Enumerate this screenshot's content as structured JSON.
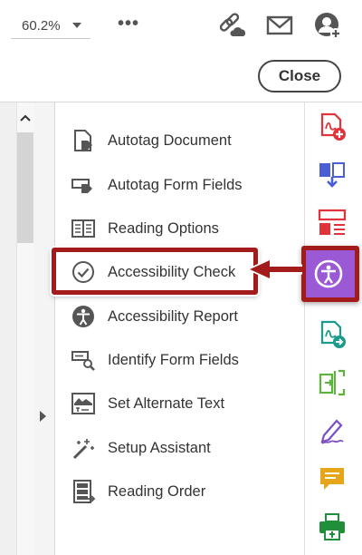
{
  "toolbar": {
    "zoom_value": "60.2%",
    "more_label": "•••",
    "icons": [
      "share-link-icon",
      "email-icon",
      "add-user-icon"
    ]
  },
  "close_bar": {
    "close_label": "Close"
  },
  "menu": {
    "items": [
      {
        "label": "Autotag Document",
        "icon": "autotag-document-icon"
      },
      {
        "label": "Autotag Form Fields",
        "icon": "autotag-form-fields-icon"
      },
      {
        "label": "Reading Options",
        "icon": "reading-options-icon"
      },
      {
        "label": "Accessibility Check",
        "icon": "accessibility-check-icon"
      },
      {
        "label": "Accessibility Report",
        "icon": "accessibility-report-icon"
      },
      {
        "label": "Identify Form Fields",
        "icon": "identify-form-fields-icon"
      },
      {
        "label": "Set Alternate Text",
        "icon": "set-alternate-text-icon"
      },
      {
        "label": "Setup Assistant",
        "icon": "setup-assistant-icon"
      },
      {
        "label": "Reading Order",
        "icon": "reading-order-icon"
      }
    ]
  },
  "rail": {
    "icons": [
      "create-pdf-icon",
      "combine-files-icon",
      "organize-pages-icon",
      "accessibility-icon",
      "export-pdf-icon",
      "edit-pdf-icon",
      "fill-sign-icon",
      "comment-icon",
      "print-production-icon"
    ]
  },
  "colors": {
    "highlight": "#a31b1b",
    "accessibility_active": "#9b59d6",
    "create_red": "#e0343a",
    "combine_blue": "#4a5fd6",
    "export_teal": "#1a9b8c",
    "edit_green": "#5db33e",
    "sign_purple": "#7b4fc4",
    "comment_yellow": "#e5a619"
  }
}
